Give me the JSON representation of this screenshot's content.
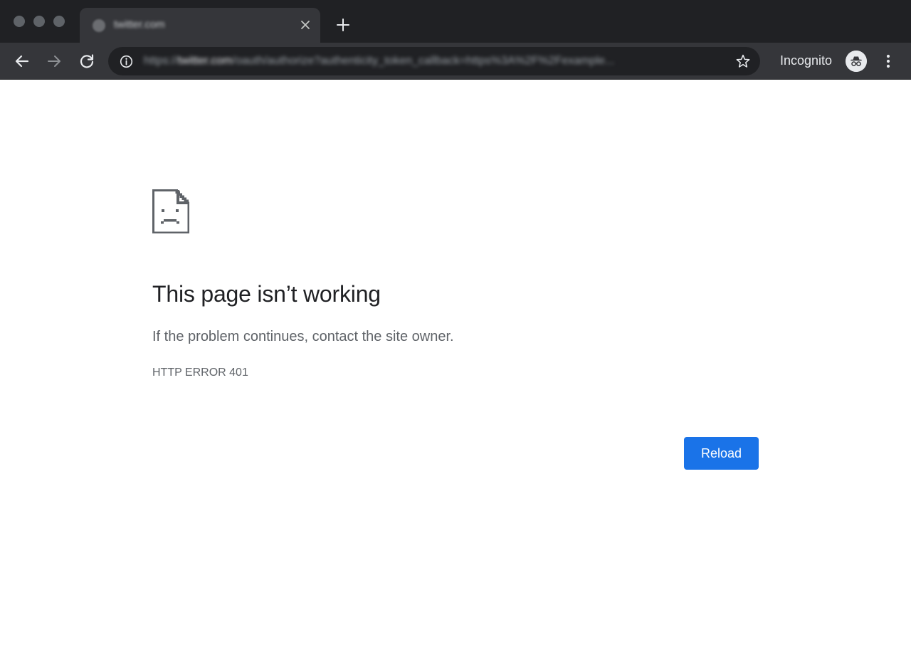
{
  "tab": {
    "title": "twitter.com",
    "favicon": "globe-icon"
  },
  "toolbar": {
    "url_host": "twitter.com",
    "url_prefix": "https://",
    "url_rest": "/oauth/authorize?authenticity_token_callback=https%3A%2F%2Fexample...",
    "incognito_label": "Incognito"
  },
  "error_page": {
    "icon": "sad-page-icon",
    "heading": "This page isn’t working",
    "message": "If the problem continues, contact the site owner.",
    "error_code": "HTTP ERROR 401",
    "reload_label": "Reload"
  },
  "colors": {
    "titlebar": "#202124",
    "toolbar": "#35363a",
    "accent": "#1a73e8",
    "heading": "#202124",
    "secondary_text": "#5f6368"
  }
}
